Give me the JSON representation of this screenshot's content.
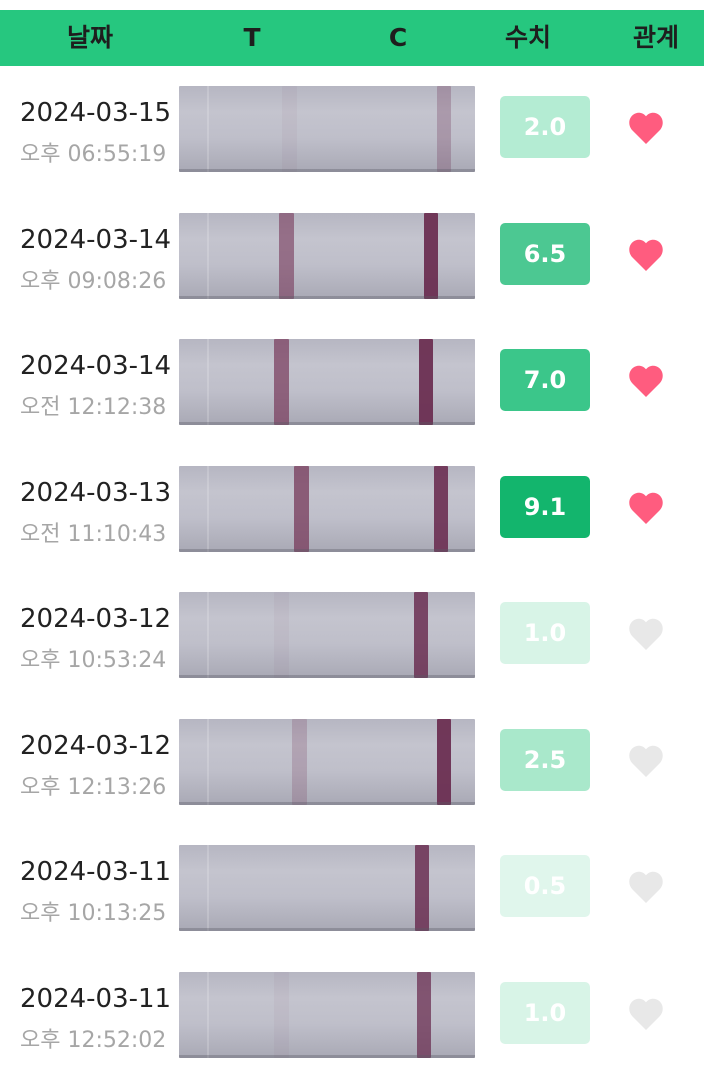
{
  "header": {
    "date_label": "날짜",
    "t_label": "T",
    "c_label": "C",
    "value_label": "수치",
    "relationship_label": "관계"
  },
  "colors": {
    "header_bg": "#26c77f",
    "heart_active": "#ff5c7f",
    "heart_inactive": "#e8e8e8"
  },
  "records": [
    {
      "date": "2024-03-15",
      "time": "오후 06:55:19",
      "value": "2.0",
      "value_color": "#b4ecd3",
      "t_line": 0.05,
      "c_line": 0.28,
      "relationship": true
    },
    {
      "date": "2024-03-14",
      "time": "오후 09:08:26",
      "value": "6.5",
      "value_color": "#4cc892",
      "t_line": 0.65,
      "c_line": 0.95,
      "relationship": true
    },
    {
      "date": "2024-03-14",
      "time": "오전 12:12:38",
      "value": "7.0",
      "value_color": "#3bc68a",
      "t_line": 0.75,
      "c_line": 0.95,
      "relationship": true
    },
    {
      "date": "2024-03-13",
      "time": "오전 11:10:43",
      "value": "9.1",
      "value_color": "#13b56d",
      "t_line": 0.8,
      "c_line": 0.9,
      "relationship": true
    },
    {
      "date": "2024-03-12",
      "time": "오후 10:53:24",
      "value": "1.0",
      "value_color": "#d8f4e7",
      "t_line": 0.05,
      "c_line": 0.85,
      "relationship": false
    },
    {
      "date": "2024-03-12",
      "time": "오후 12:13:26",
      "value": "2.5",
      "value_color": "#a9e8cb",
      "t_line": 0.25,
      "c_line": 0.95,
      "relationship": false
    },
    {
      "date": "2024-03-11",
      "time": "오후 10:13:25",
      "value": "0.5",
      "value_color": "#e0f6ec",
      "t_line": 0.0,
      "c_line": 0.85,
      "relationship": false
    },
    {
      "date": "2024-03-11",
      "time": "오후 12:52:02",
      "value": "1.0",
      "value_color": "#d8f4e7",
      "t_line": 0.05,
      "c_line": 0.75,
      "relationship": false
    }
  ]
}
